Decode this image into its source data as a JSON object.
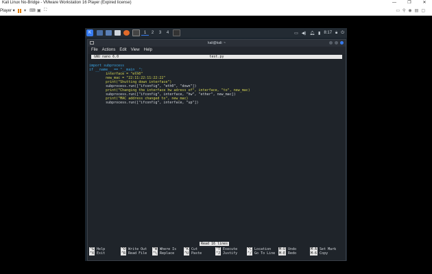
{
  "host": {
    "title": "Kali Linux No-Bridge - VMware Workstation 16 Player (Expired license)",
    "player_label": "Player",
    "window_controls": [
      "—",
      "❐",
      "✕"
    ],
    "colors": {
      "pause": "#e07b00",
      "titlebar": "#ffffff"
    }
  },
  "panel": {
    "workspaces": [
      "1",
      "2",
      "3",
      "4"
    ],
    "active_workspace": "1",
    "time": "8:17",
    "accent": "#367bf0"
  },
  "terminal": {
    "title": "kali@kali: ~",
    "menu": [
      "File",
      "Actions",
      "Edit",
      "View",
      "Help"
    ]
  },
  "nano": {
    "version": "GNU nano 6.0",
    "filename": "test.py",
    "status": "Read 16 lines",
    "code_lines": [
      "import subprocess",
      "",
      "if __name__ == \"__main__\":",
      "        interface = \"eth0\"",
      "        new_mac = \"22:11:22:11:22:22\"",
      "",
      "        print(\"Shutting down interface\")",
      "        subprocess.run([\"ifconfig\", \"eth0\", \"down\"])",
      "",
      "        print(\"Changing the interface hw adress of\", interface, \"to\", new_mac)",
      "        subprocess.run([\"ifconfig\", interface, \"hw\", \"ether\", new_mac])",
      "",
      "        print(\"MAC address changed to\", new_mac)",
      "        subprocess.run([\"ifconfig\", interface, \"up\"])"
    ],
    "shortcuts": [
      {
        "key": "^G",
        "label": "Help"
      },
      {
        "key": "^X",
        "label": "Exit"
      },
      {
        "key": "^O",
        "label": "Write Out"
      },
      {
        "key": "^R",
        "label": "Read File"
      },
      {
        "key": "^W",
        "label": "Where Is"
      },
      {
        "key": "^\\",
        "label": "Replace"
      },
      {
        "key": "^K",
        "label": "Cut"
      },
      {
        "key": "^U",
        "label": "Paste"
      },
      {
        "key": "^T",
        "label": "Execute"
      },
      {
        "key": "^J",
        "label": "Justify"
      },
      {
        "key": "^C",
        "label": "Location"
      },
      {
        "key": "^/",
        "label": "Go To Line"
      },
      {
        "key": "M-U",
        "label": "Undo"
      },
      {
        "key": "M-E",
        "label": "Redo"
      },
      {
        "key": "M-A",
        "label": "Set Mark"
      },
      {
        "key": "M-6",
        "label": "Copy"
      }
    ]
  }
}
